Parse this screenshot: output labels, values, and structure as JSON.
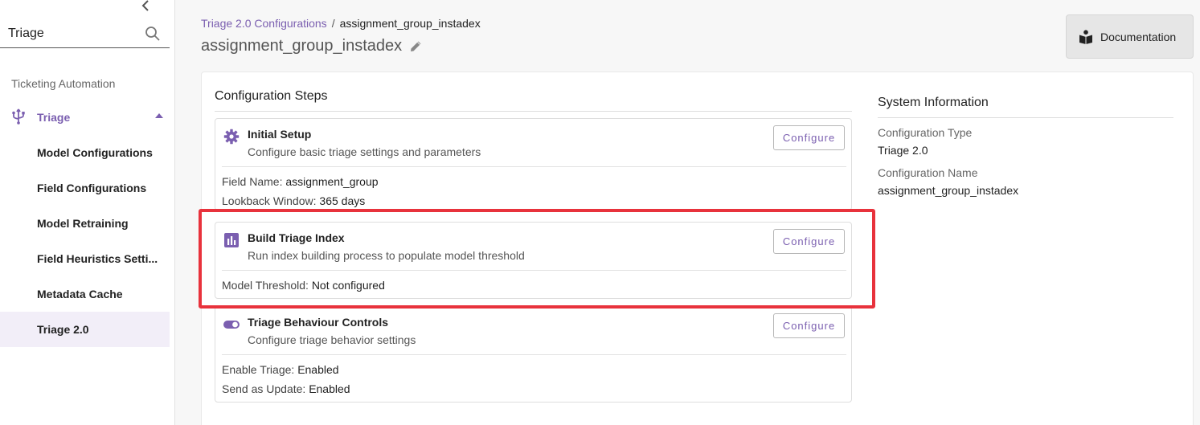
{
  "sidebar": {
    "search": {
      "value": "Triage",
      "placeholder": ""
    },
    "section_label": "Ticketing Automation",
    "parent": {
      "label": "Triage"
    },
    "items": [
      {
        "label": "Model Configurations"
      },
      {
        "label": "Field Configurations"
      },
      {
        "label": "Model Retraining"
      },
      {
        "label": "Field Heuristics Setti..."
      },
      {
        "label": "Metadata Cache"
      },
      {
        "label": "Triage 2.0"
      }
    ]
  },
  "header": {
    "breadcrumb_link": "Triage 2.0 Configurations",
    "breadcrumb_sep": "/",
    "breadcrumb_current": "assignment_group_instadex",
    "title": "assignment_group_instadex",
    "doc_button": "Documentation"
  },
  "steps": {
    "heading": "Configuration Steps",
    "configure_label": "Configure",
    "items": [
      {
        "title": "Initial Setup",
        "description": "Configure basic triage settings and parameters",
        "icon": "gear-icon",
        "fields": [
          {
            "key": "Field Name:",
            "value": "assignment_group"
          },
          {
            "key": "Lookback Window:",
            "value": "365 days"
          }
        ]
      },
      {
        "title": "Build Triage Index",
        "description": "Run index building process to populate model threshold",
        "icon": "bar-chart-icon",
        "fields": [
          {
            "key": "Model Threshold:",
            "value": "Not configured"
          }
        ]
      },
      {
        "title": "Triage Behaviour Controls",
        "description": "Configure triage behavior settings",
        "icon": "toggle-icon",
        "fields": [
          {
            "key": "Enable Triage:",
            "value": "Enabled"
          },
          {
            "key": "Send as Update:",
            "value": "Enabled"
          }
        ]
      }
    ]
  },
  "system_info": {
    "heading": "System Information",
    "type_label": "Configuration Type",
    "type_value": "Triage 2.0",
    "name_label": "Configuration Name",
    "name_value": "assignment_group_instadex"
  },
  "colors": {
    "accent": "#7b5fb0",
    "highlight": "#e8323c",
    "active_bg": "#f2eef8"
  }
}
